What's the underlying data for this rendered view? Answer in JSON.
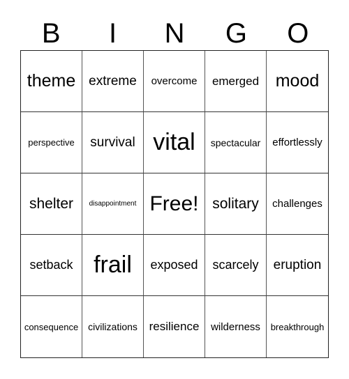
{
  "header": {
    "letters": [
      "B",
      "I",
      "N",
      "G",
      "O"
    ]
  },
  "cells": [
    "theme",
    "extreme",
    "overcome",
    "emerged",
    "mood",
    "perspective",
    "survival",
    "vital",
    "spectacular",
    "effortlessly",
    "shelter",
    "disappointment",
    "Free!",
    "solitary",
    "challenges",
    "setback",
    "frail",
    "exposed",
    "scarcely",
    "eruption",
    "consequence",
    "civilizations",
    "resilience",
    "wilderness",
    "breakthrough"
  ]
}
